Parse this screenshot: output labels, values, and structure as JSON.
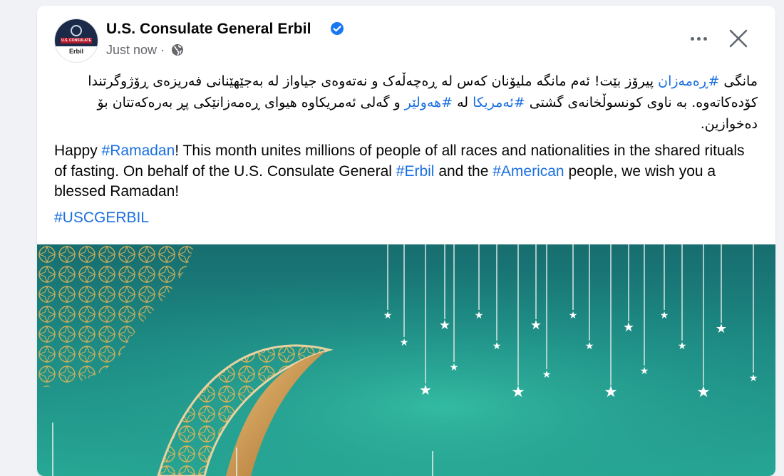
{
  "post": {
    "page_name": "U.S. Consulate General Erbil",
    "timestamp": "Just now",
    "avatar": {
      "top_text": "U.S. CONSULATE",
      "bottom_text": "Erbil"
    },
    "icons": {
      "verified": "verified-badge-icon",
      "privacy": "globe-icon",
      "more": "more-options-icon",
      "close": "close-icon"
    },
    "kurdish": {
      "p1": "مانگی ",
      "tag1": "#ڕەمەزان",
      "p2": " پیرۆز بێت! ئەم مانگە ملیۆنان کەس لە ڕەچەڵەک و نەتەوەی جیاواز لە بەجێهێنانی فەریزەی ڕۆژوگرتندا کۆدەکاتەوە. بە ناوی کونسوڵخانەی گشتی ",
      "tag2": "#ئەمریکا",
      "p3": " لە ",
      "tag3": "#هەولێر",
      "p4": " و گەلی ئەمریکاوە هیوای ڕەمەزانێکی پڕ بەرەکەتتان بۆ دەخوازین."
    },
    "english": {
      "p1": "Happy ",
      "tag1": "#Ramadan",
      "p2": "! This month unites millions of people of all races and nationalities in the shared rituals of fasting. On behalf of the U.S. Consulate General ",
      "tag2": "#Erbil",
      "p3": " and the ",
      "tag3": "#American",
      "p4": " people, we wish you a blessed Ramadan!"
    },
    "hashtag_line": "#USCGERBIL",
    "image_icon": "ramadan-crescent-illustration",
    "colors": {
      "link": "#1a6fe0",
      "verified": "#1877f2",
      "teal_background": "#1d8b84",
      "gold": "#d9b25a",
      "navy": "#1b2a49"
    }
  }
}
